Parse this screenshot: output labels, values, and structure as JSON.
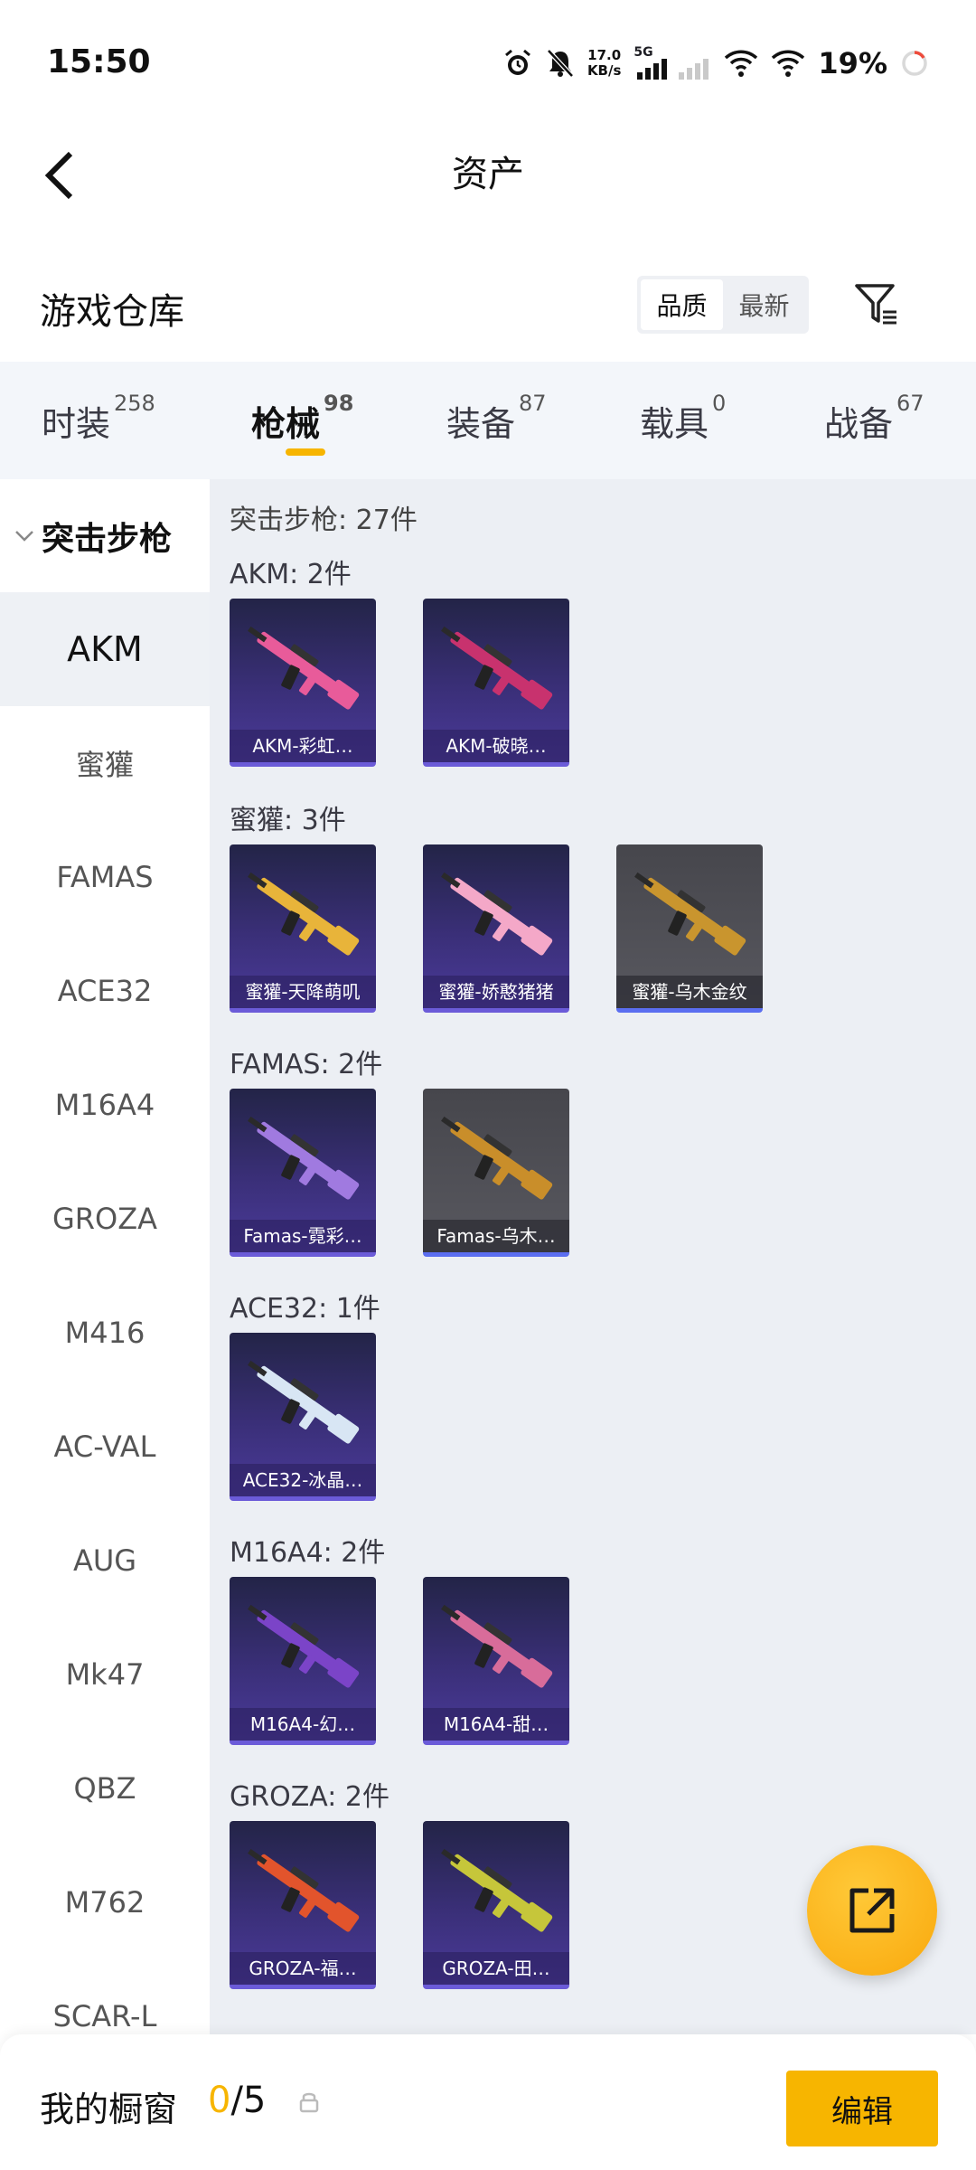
{
  "status": {
    "time": "15:50",
    "net_speed_value": "17.0",
    "net_speed_unit": "KB/s",
    "network": "5G",
    "battery": "19%"
  },
  "header": {
    "title": "资产"
  },
  "warehouse": {
    "title": "游戏仓库",
    "sort_options": [
      "品质",
      "最新"
    ],
    "sort_selected": "品质"
  },
  "tabs": [
    {
      "label": "时装",
      "count": "258"
    },
    {
      "label": "枪械",
      "count": "98"
    },
    {
      "label": "装备",
      "count": "87"
    },
    {
      "label": "载具",
      "count": "0"
    },
    {
      "label": "战备",
      "count": "67"
    }
  ],
  "sidebar": {
    "category": "突击步枪",
    "items": [
      "AKM",
      "蜜獾",
      "FAMAS",
      "ACE32",
      "M16A4",
      "GROZA",
      "M416",
      "AC-VAL",
      "AUG",
      "Mk47",
      "QBZ",
      "M762",
      "SCAR-L"
    ],
    "selected": "AKM"
  },
  "content": {
    "total": "突击步枪: 27件",
    "groups": [
      {
        "label": "AKM: 2件",
        "items": [
          {
            "name": "AKM-彩虹…",
            "color": "#e85b9a",
            "tier": "purple"
          },
          {
            "name": "AKM-破晓…",
            "color": "#c8326e",
            "tier": "purple"
          }
        ]
      },
      {
        "label": "蜜獾: 3件",
        "items": [
          {
            "name": "蜜獾-天降萌叽",
            "color": "#e8b43a",
            "tier": "purple"
          },
          {
            "name": "蜜獾-娇憨猪猪",
            "color": "#f4a8c8",
            "tier": "purple"
          },
          {
            "name": "蜜獾-乌木金纹",
            "color": "#c9952e",
            "tier": "gold"
          }
        ]
      },
      {
        "label": "FAMAS: 2件",
        "items": [
          {
            "name": "Famas-霓彩…",
            "color": "#a07ae0",
            "tier": "purple"
          },
          {
            "name": "Famas-乌木…",
            "color": "#c98e2a",
            "tier": "gold"
          }
        ]
      },
      {
        "label": "ACE32: 1件",
        "items": [
          {
            "name": "ACE32-冰晶…",
            "color": "#d8e6f4",
            "tier": "purple"
          }
        ]
      },
      {
        "label": "M16A4: 2件",
        "items": [
          {
            "name": "M16A4-幻…",
            "color": "#7b44c8",
            "tier": "purple"
          },
          {
            "name": "M16A4-甜…",
            "color": "#d86c9a",
            "tier": "purple"
          }
        ]
      },
      {
        "label": "GROZA: 2件",
        "items": [
          {
            "name": "GROZA-福…",
            "color": "#e2542c",
            "tier": "purple"
          },
          {
            "name": "GROZA-田…",
            "color": "#c6c63a",
            "tier": "purple"
          }
        ]
      }
    ]
  },
  "bottom": {
    "showcase_label": "我的橱窗",
    "showcase_current": "0",
    "showcase_total": "/5",
    "edit_label": "编辑"
  },
  "colors": {
    "accent": "#f7b500",
    "content_bg": "#eceff4",
    "tabs_bg": "#f3f6fa"
  }
}
